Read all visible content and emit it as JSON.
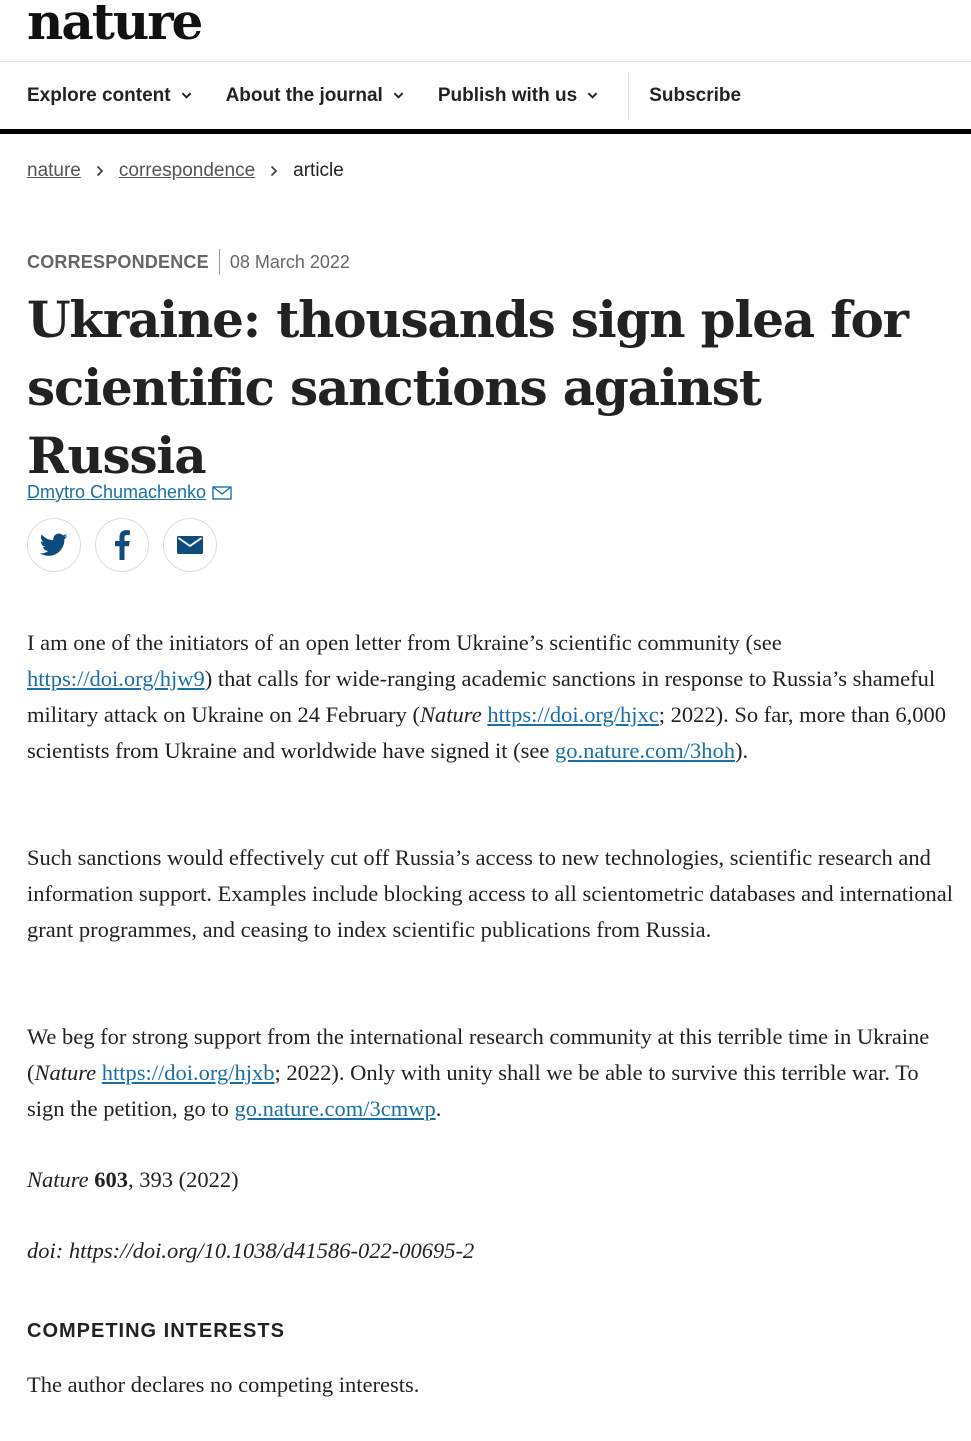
{
  "brand": {
    "logo_text": "nature"
  },
  "nav": {
    "items": [
      {
        "label": "Explore content"
      },
      {
        "label": "About the journal"
      },
      {
        "label": "Publish with us"
      }
    ],
    "subscribe_label": "Subscribe"
  },
  "breadcrumb": {
    "items": [
      "nature",
      "correspondence"
    ],
    "current": "article"
  },
  "article": {
    "type": "CORRESPONDENCE",
    "date": "08 March 2022",
    "title": "Ukraine: thousands sign plea for scientific sanctions against Russia",
    "author": "Dmytro Chumachenko",
    "paragraphs": {
      "p1": {
        "t1": "I am one of the initiators of an open letter from Ukraine’s scientific community (see ",
        "l1": "https://doi.org/hjw9",
        "t2": ") that calls for wide-ranging academic sanctions in response to Russia’s shameful military attack on Ukraine on 24 February (",
        "i1": "Nature",
        "t3": " ",
        "l2": "https://doi.org/hjxc",
        "t4": "; 2022). So far, more than 6,000 scientists from Ukraine and worldwide have signed it (see ",
        "l3": "go.nature.com/3hoh",
        "t5": ")."
      },
      "p2": "Such sanctions would effectively cut off Russia’s access to new technologies, scientific research and information support. Examples include blocking access to all scientometric databases and international grant programmes, and ceasing to index scientific publications from Russia.",
      "p3": {
        "t1": "We beg for strong support from the international research community at this terrible time in Ukraine (",
        "i1": "Nature",
        "t2": " ",
        "l1": "https://doi.org/hjxb",
        "t3": "; 2022). Only with unity shall we be able to survive this terrible war. To sign the petition, go to ",
        "l2": "go.nature.com/3cmwp",
        "t4": "."
      }
    },
    "citation": {
      "journal": "Nature",
      "volume": "603",
      "rest": ", 393 (2022)"
    },
    "doi": "doi: https://doi.org/10.1038/d41586-022-00695-2",
    "competing_interests": {
      "heading": "COMPETING INTERESTS",
      "text": "The author declares no competing interests."
    }
  },
  "colors": {
    "link": "#1a6fa8",
    "text": "#222222",
    "rule": "#000000"
  },
  "icons": [
    "chevron-down-icon",
    "chevron-right-icon",
    "envelope-icon",
    "twitter-icon",
    "facebook-icon",
    "email-icon"
  ]
}
